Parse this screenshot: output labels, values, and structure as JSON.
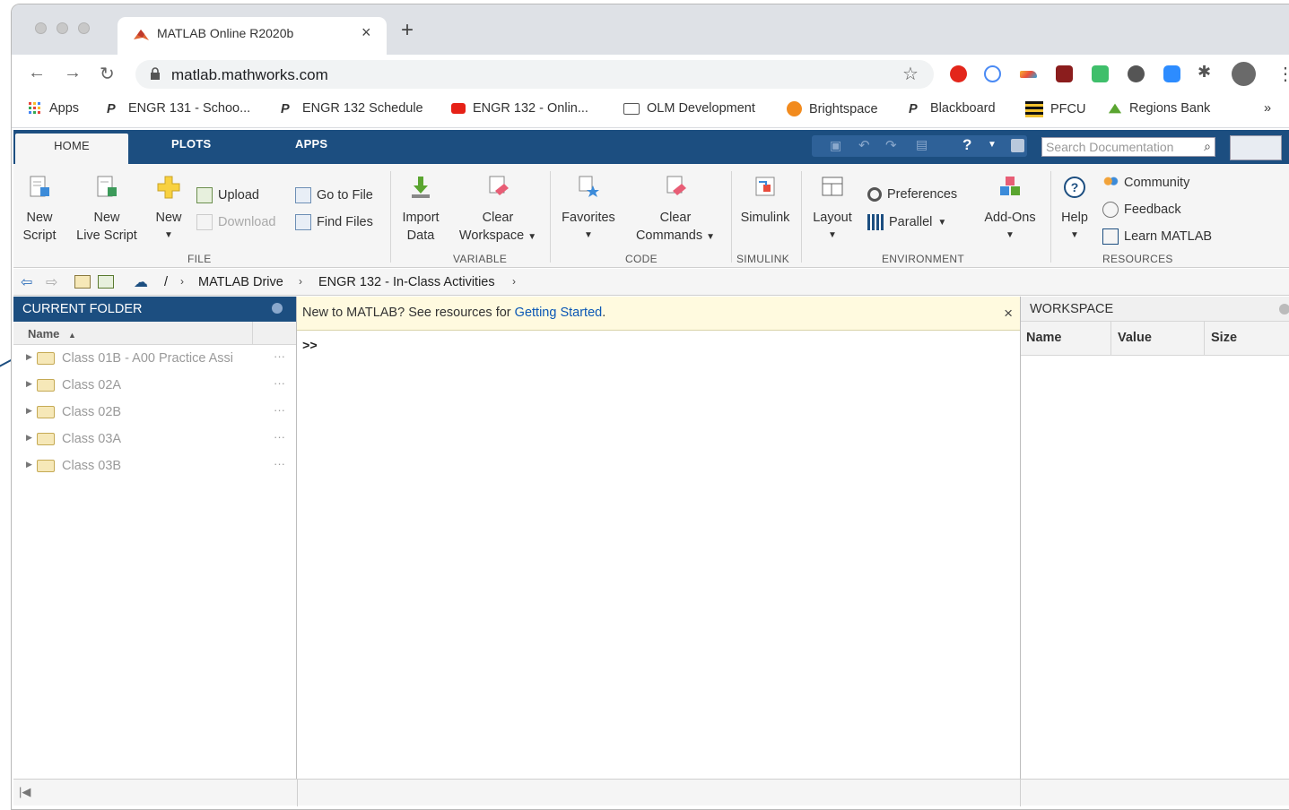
{
  "browser": {
    "tab_title": "MATLAB Online R2020b",
    "tab_close": "×",
    "new_tab": "+",
    "url": "matlab.mathworks.com",
    "bookmarks": [
      {
        "label": "Apps"
      },
      {
        "label": "ENGR 131 - Schoo..."
      },
      {
        "label": "ENGR 132 Schedule"
      },
      {
        "label": "ENGR 132 - Onlin..."
      },
      {
        "label": "OLM Development"
      },
      {
        "label": "Brightspace"
      },
      {
        "label": "Blackboard"
      },
      {
        "label": "PFCU"
      },
      {
        "label": "Regions Bank"
      }
    ],
    "more_bookmarks": "»"
  },
  "matlab": {
    "tabs": [
      "HOME",
      "PLOTS",
      "APPS"
    ],
    "search_placeholder": "Search Documentation",
    "ribbon": {
      "new_script": "New\nScript",
      "new_live_script": "New\nLive Script",
      "new": "New",
      "upload": "Upload",
      "download": "Download",
      "go_to_file": "Go to File",
      "find_files": "Find Files",
      "import_data": "Import\nData",
      "clear_workspace": "Clear\nWorkspace",
      "favorites": "Favorites",
      "clear_commands": "Clear\nCommands",
      "simulink": "Simulink",
      "layout": "Layout",
      "preferences": "Preferences",
      "parallel": "Parallel",
      "add_ons": "Add-Ons",
      "help": "Help",
      "community": "Community",
      "feedback": "Feedback",
      "learn_matlab": "Learn MATLAB",
      "groups": [
        "FILE",
        "VARIABLE",
        "CODE",
        "SIMULINK",
        "ENVIRONMENT",
        "RESOURCES"
      ]
    },
    "path": {
      "root": "/",
      "crumbs": [
        "MATLAB Drive",
        "ENGR 132 - In-Class Activities"
      ]
    },
    "current_folder": {
      "title": "CURRENT FOLDER",
      "column": "Name",
      "items": [
        "Class 01B - A00 Practice Assi",
        "Class 02A",
        "Class 02B",
        "Class 03A",
        "Class 03B"
      ],
      "item_menu": "···"
    },
    "command_window": {
      "banner_text": "New to MATLAB? See resources for ",
      "banner_link": "Getting Started",
      "banner_end": ".",
      "banner_close": "×",
      "prompt": ">>"
    },
    "workspace": {
      "title": "WORKSPACE",
      "columns": [
        "Name",
        "Value",
        "Size"
      ]
    }
  }
}
